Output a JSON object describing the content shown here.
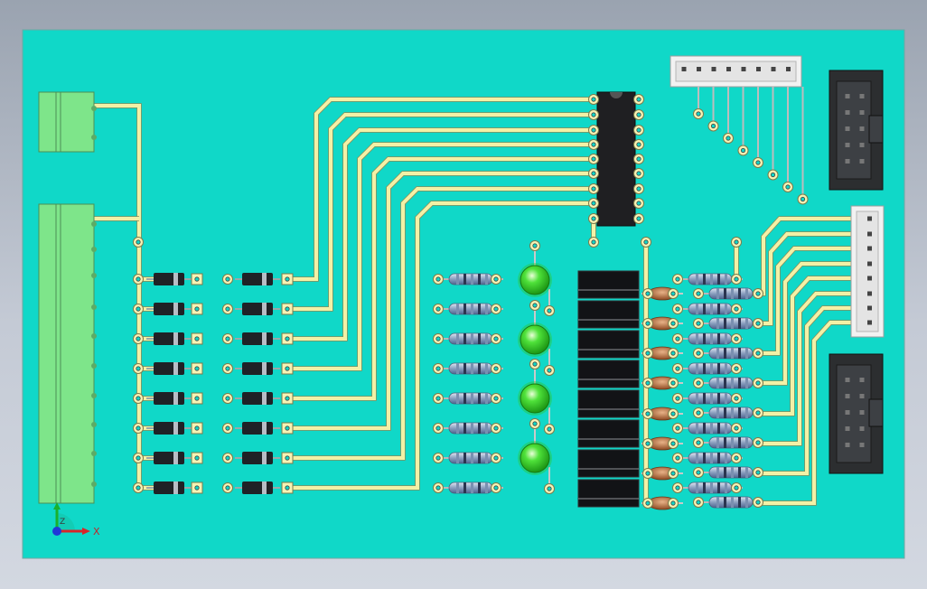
{
  "view": {
    "background": "gradient-gray-blue",
    "board_color": "#10d8c8",
    "trace_color": "#f3f1a6",
    "axis_triad": {
      "x_label": "X",
      "z_label": "Z"
    }
  },
  "components": {
    "screw_terminal_2pin": "green-terminal-block",
    "screw_terminal_8pin": "green-terminal-block",
    "diodes": {
      "columns": 2,
      "rows": 8
    },
    "ic": {
      "pins_per_side": 9
    },
    "resistors_left": {
      "count": 8
    },
    "leds": {
      "count": 4,
      "color": "#2fc722"
    },
    "relays": {
      "count": 8
    },
    "ceramic_caps": {
      "count": 8
    },
    "resistors_right": {
      "count": 16
    },
    "connectors": {
      "top_header_pins": 8,
      "side_header_pins": 8,
      "idc_headers": 2
    }
  }
}
